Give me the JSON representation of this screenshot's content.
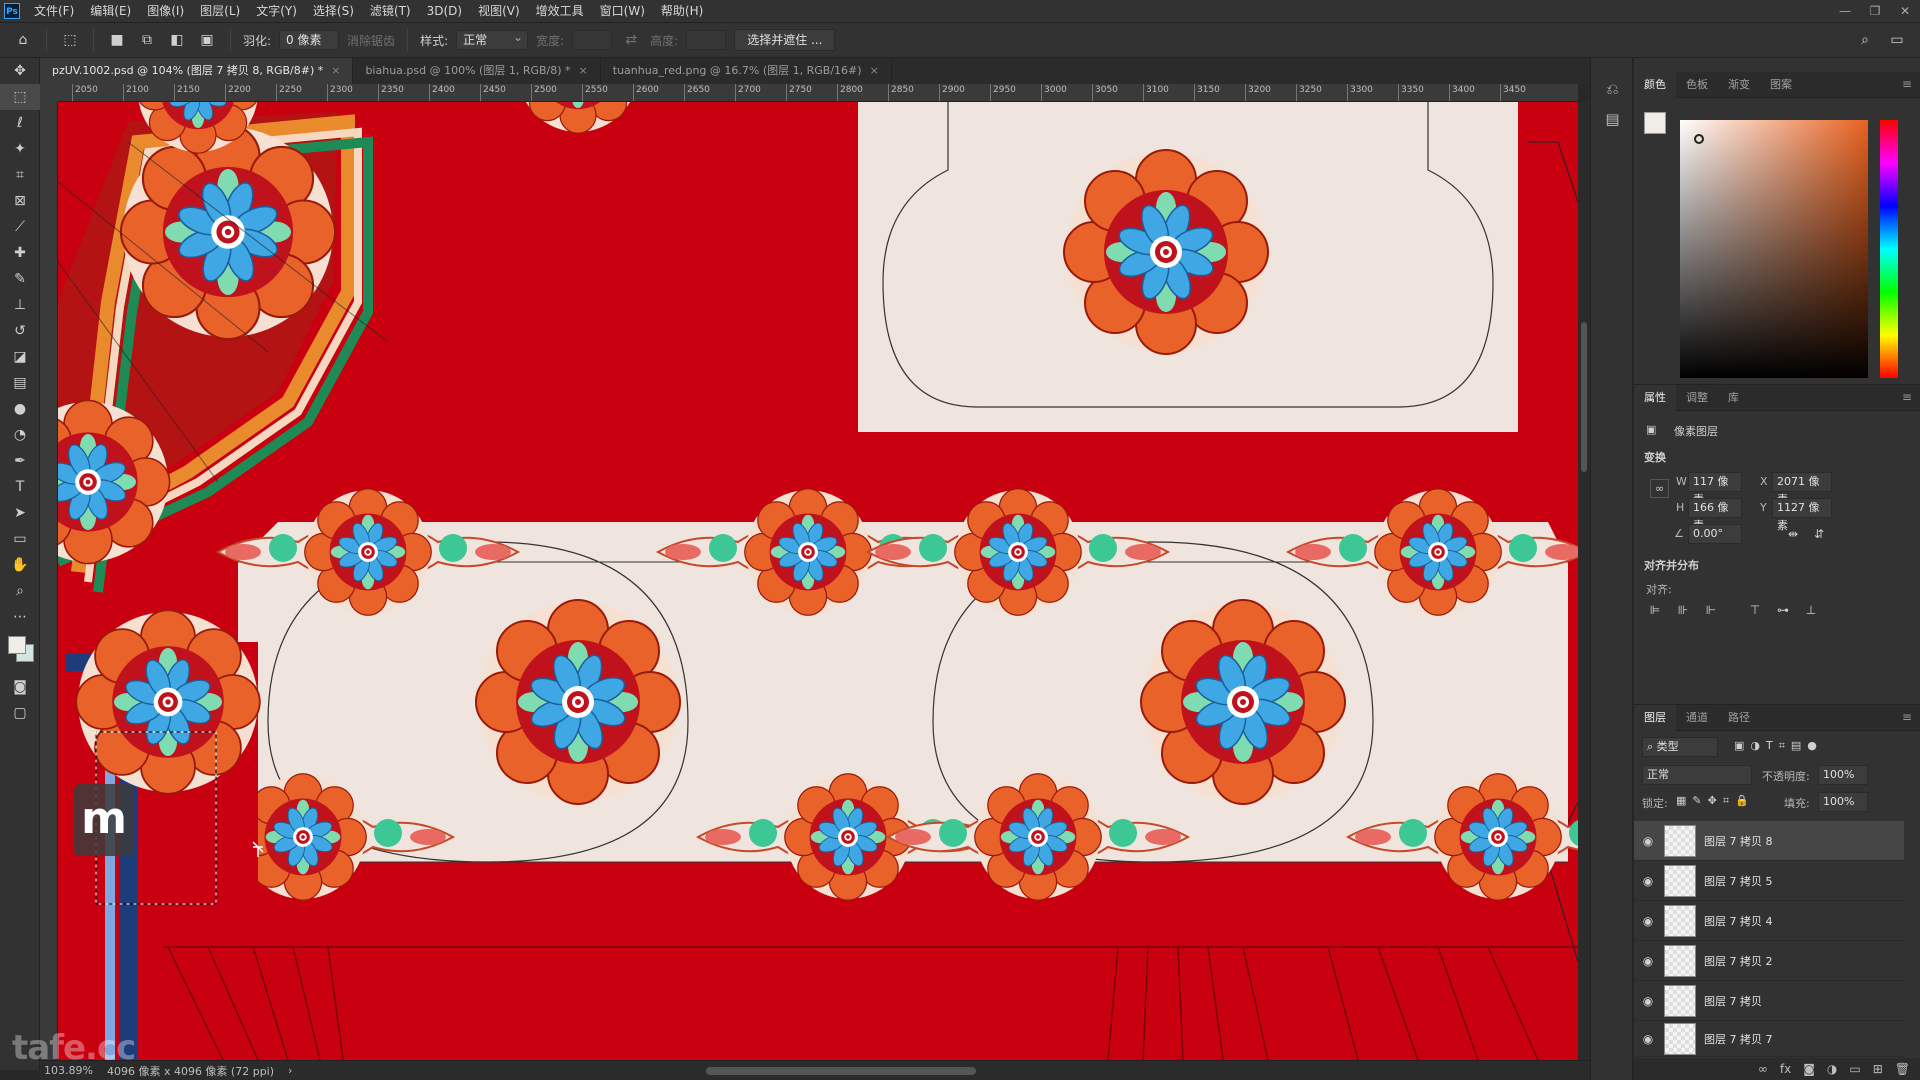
{
  "menubar": {
    "logo": "Ps",
    "items": [
      "文件(F)",
      "编辑(E)",
      "图像(I)",
      "图层(L)",
      "文字(Y)",
      "选择(S)",
      "滤镜(T)",
      "3D(D)",
      "视图(V)",
      "增效工具",
      "窗口(W)",
      "帮助(H)"
    ],
    "win_controls": [
      "—",
      "❐",
      "✕"
    ]
  },
  "options": {
    "feather_label": "羽化:",
    "feather_value": "0 像素",
    "antialias_label": "消除锯齿",
    "style_label": "样式:",
    "style_value": "正常",
    "width_label": "宽度:",
    "height_label": "高度:",
    "select_mask_button": "选择并遮住 ..."
  },
  "tabs": [
    {
      "label": "pzUV.1002.psd @ 104% (图层 7 拷贝 8, RGB/8#) *",
      "close": "×"
    },
    {
      "label": "biahua.psd @ 100% (图层 1, RGB/8) *",
      "close": "×"
    },
    {
      "label": "tuanhua_red.png @ 16.7% (图层 1, RGB/16#)",
      "close": "×"
    }
  ],
  "ruler_ticks": [
    "2050",
    "2100",
    "2150",
    "2200",
    "2250",
    "2300",
    "2350",
    "2400",
    "2450",
    "2500",
    "2550",
    "2600",
    "2650",
    "2700",
    "2750",
    "2800",
    "2850",
    "2900",
    "2950",
    "3000",
    "3050",
    "3100",
    "3150",
    "3200",
    "3250",
    "3300",
    "3350",
    "3400",
    "3450"
  ],
  "status": {
    "zoom": "103.89%",
    "doc_info": "4096 像素 x 4096 像素 (72 ppi)",
    "arrow": "›"
  },
  "color_panel": {
    "tabs": [
      "颜色",
      "色板",
      "渐变",
      "图案"
    ],
    "fg_color": "#f0ede8",
    "bg_color": "#cfe7dc"
  },
  "properties": {
    "tabs": [
      "属性",
      "调整",
      "库"
    ],
    "layer_type": "像素图层",
    "transform_title": "变换",
    "w_label": "W",
    "w_value": "117 像素",
    "x_label": "X",
    "x_value": "2071 像素",
    "h_label": "H",
    "h_value": "166 像素",
    "y_label": "Y",
    "y_value": "1127 像素",
    "angle_value": "0.00°",
    "align_title": "对齐并分布",
    "align_label": "对齐:"
  },
  "layers": {
    "tabs": [
      "图层",
      "通道",
      "路径"
    ],
    "filter_label": "类型",
    "blend_mode": "正常",
    "opacity_label": "不透明度:",
    "opacity_value": "100%",
    "lock_label": "锁定:",
    "fill_label": "填充:",
    "fill_value": "100%",
    "items": [
      {
        "name": "图层 7 拷贝 8",
        "selected": true
      },
      {
        "name": "图层 7 拷贝 5",
        "selected": false
      },
      {
        "name": "图层 7 拷贝 4",
        "selected": false
      },
      {
        "name": "图层 7 拷贝 2",
        "selected": false
      },
      {
        "name": "图层 7 拷贝",
        "selected": false
      },
      {
        "name": "图层 7 拷贝 7",
        "selected": false
      }
    ]
  },
  "overlay": {
    "m_badge": "m",
    "watermark": "tafe.cc"
  },
  "colors": {
    "canvas_red": "#c8000f",
    "panel_bg": "#f0e4de",
    "ui_dark": "#323232"
  }
}
